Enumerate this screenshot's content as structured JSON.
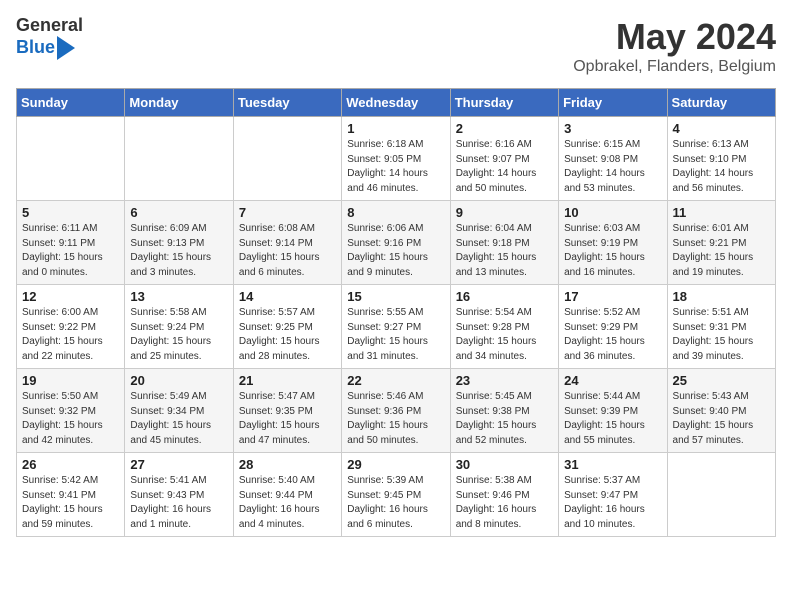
{
  "header": {
    "logo_general": "General",
    "logo_blue": "Blue",
    "title": "May 2024",
    "subtitle": "Opbrakel, Flanders, Belgium"
  },
  "days_of_week": [
    "Sunday",
    "Monday",
    "Tuesday",
    "Wednesday",
    "Thursday",
    "Friday",
    "Saturday"
  ],
  "weeks": [
    [
      {
        "num": "",
        "info": ""
      },
      {
        "num": "",
        "info": ""
      },
      {
        "num": "",
        "info": ""
      },
      {
        "num": "1",
        "info": "Sunrise: 6:18 AM\nSunset: 9:05 PM\nDaylight: 14 hours\nand 46 minutes."
      },
      {
        "num": "2",
        "info": "Sunrise: 6:16 AM\nSunset: 9:07 PM\nDaylight: 14 hours\nand 50 minutes."
      },
      {
        "num": "3",
        "info": "Sunrise: 6:15 AM\nSunset: 9:08 PM\nDaylight: 14 hours\nand 53 minutes."
      },
      {
        "num": "4",
        "info": "Sunrise: 6:13 AM\nSunset: 9:10 PM\nDaylight: 14 hours\nand 56 minutes."
      }
    ],
    [
      {
        "num": "5",
        "info": "Sunrise: 6:11 AM\nSunset: 9:11 PM\nDaylight: 15 hours\nand 0 minutes."
      },
      {
        "num": "6",
        "info": "Sunrise: 6:09 AM\nSunset: 9:13 PM\nDaylight: 15 hours\nand 3 minutes."
      },
      {
        "num": "7",
        "info": "Sunrise: 6:08 AM\nSunset: 9:14 PM\nDaylight: 15 hours\nand 6 minutes."
      },
      {
        "num": "8",
        "info": "Sunrise: 6:06 AM\nSunset: 9:16 PM\nDaylight: 15 hours\nand 9 minutes."
      },
      {
        "num": "9",
        "info": "Sunrise: 6:04 AM\nSunset: 9:18 PM\nDaylight: 15 hours\nand 13 minutes."
      },
      {
        "num": "10",
        "info": "Sunrise: 6:03 AM\nSunset: 9:19 PM\nDaylight: 15 hours\nand 16 minutes."
      },
      {
        "num": "11",
        "info": "Sunrise: 6:01 AM\nSunset: 9:21 PM\nDaylight: 15 hours\nand 19 minutes."
      }
    ],
    [
      {
        "num": "12",
        "info": "Sunrise: 6:00 AM\nSunset: 9:22 PM\nDaylight: 15 hours\nand 22 minutes."
      },
      {
        "num": "13",
        "info": "Sunrise: 5:58 AM\nSunset: 9:24 PM\nDaylight: 15 hours\nand 25 minutes."
      },
      {
        "num": "14",
        "info": "Sunrise: 5:57 AM\nSunset: 9:25 PM\nDaylight: 15 hours\nand 28 minutes."
      },
      {
        "num": "15",
        "info": "Sunrise: 5:55 AM\nSunset: 9:27 PM\nDaylight: 15 hours\nand 31 minutes."
      },
      {
        "num": "16",
        "info": "Sunrise: 5:54 AM\nSunset: 9:28 PM\nDaylight: 15 hours\nand 34 minutes."
      },
      {
        "num": "17",
        "info": "Sunrise: 5:52 AM\nSunset: 9:29 PM\nDaylight: 15 hours\nand 36 minutes."
      },
      {
        "num": "18",
        "info": "Sunrise: 5:51 AM\nSunset: 9:31 PM\nDaylight: 15 hours\nand 39 minutes."
      }
    ],
    [
      {
        "num": "19",
        "info": "Sunrise: 5:50 AM\nSunset: 9:32 PM\nDaylight: 15 hours\nand 42 minutes."
      },
      {
        "num": "20",
        "info": "Sunrise: 5:49 AM\nSunset: 9:34 PM\nDaylight: 15 hours\nand 45 minutes."
      },
      {
        "num": "21",
        "info": "Sunrise: 5:47 AM\nSunset: 9:35 PM\nDaylight: 15 hours\nand 47 minutes."
      },
      {
        "num": "22",
        "info": "Sunrise: 5:46 AM\nSunset: 9:36 PM\nDaylight: 15 hours\nand 50 minutes."
      },
      {
        "num": "23",
        "info": "Sunrise: 5:45 AM\nSunset: 9:38 PM\nDaylight: 15 hours\nand 52 minutes."
      },
      {
        "num": "24",
        "info": "Sunrise: 5:44 AM\nSunset: 9:39 PM\nDaylight: 15 hours\nand 55 minutes."
      },
      {
        "num": "25",
        "info": "Sunrise: 5:43 AM\nSunset: 9:40 PM\nDaylight: 15 hours\nand 57 minutes."
      }
    ],
    [
      {
        "num": "26",
        "info": "Sunrise: 5:42 AM\nSunset: 9:41 PM\nDaylight: 15 hours\nand 59 minutes."
      },
      {
        "num": "27",
        "info": "Sunrise: 5:41 AM\nSunset: 9:43 PM\nDaylight: 16 hours\nand 1 minute."
      },
      {
        "num": "28",
        "info": "Sunrise: 5:40 AM\nSunset: 9:44 PM\nDaylight: 16 hours\nand 4 minutes."
      },
      {
        "num": "29",
        "info": "Sunrise: 5:39 AM\nSunset: 9:45 PM\nDaylight: 16 hours\nand 6 minutes."
      },
      {
        "num": "30",
        "info": "Sunrise: 5:38 AM\nSunset: 9:46 PM\nDaylight: 16 hours\nand 8 minutes."
      },
      {
        "num": "31",
        "info": "Sunrise: 5:37 AM\nSunset: 9:47 PM\nDaylight: 16 hours\nand 10 minutes."
      },
      {
        "num": "",
        "info": ""
      }
    ]
  ]
}
